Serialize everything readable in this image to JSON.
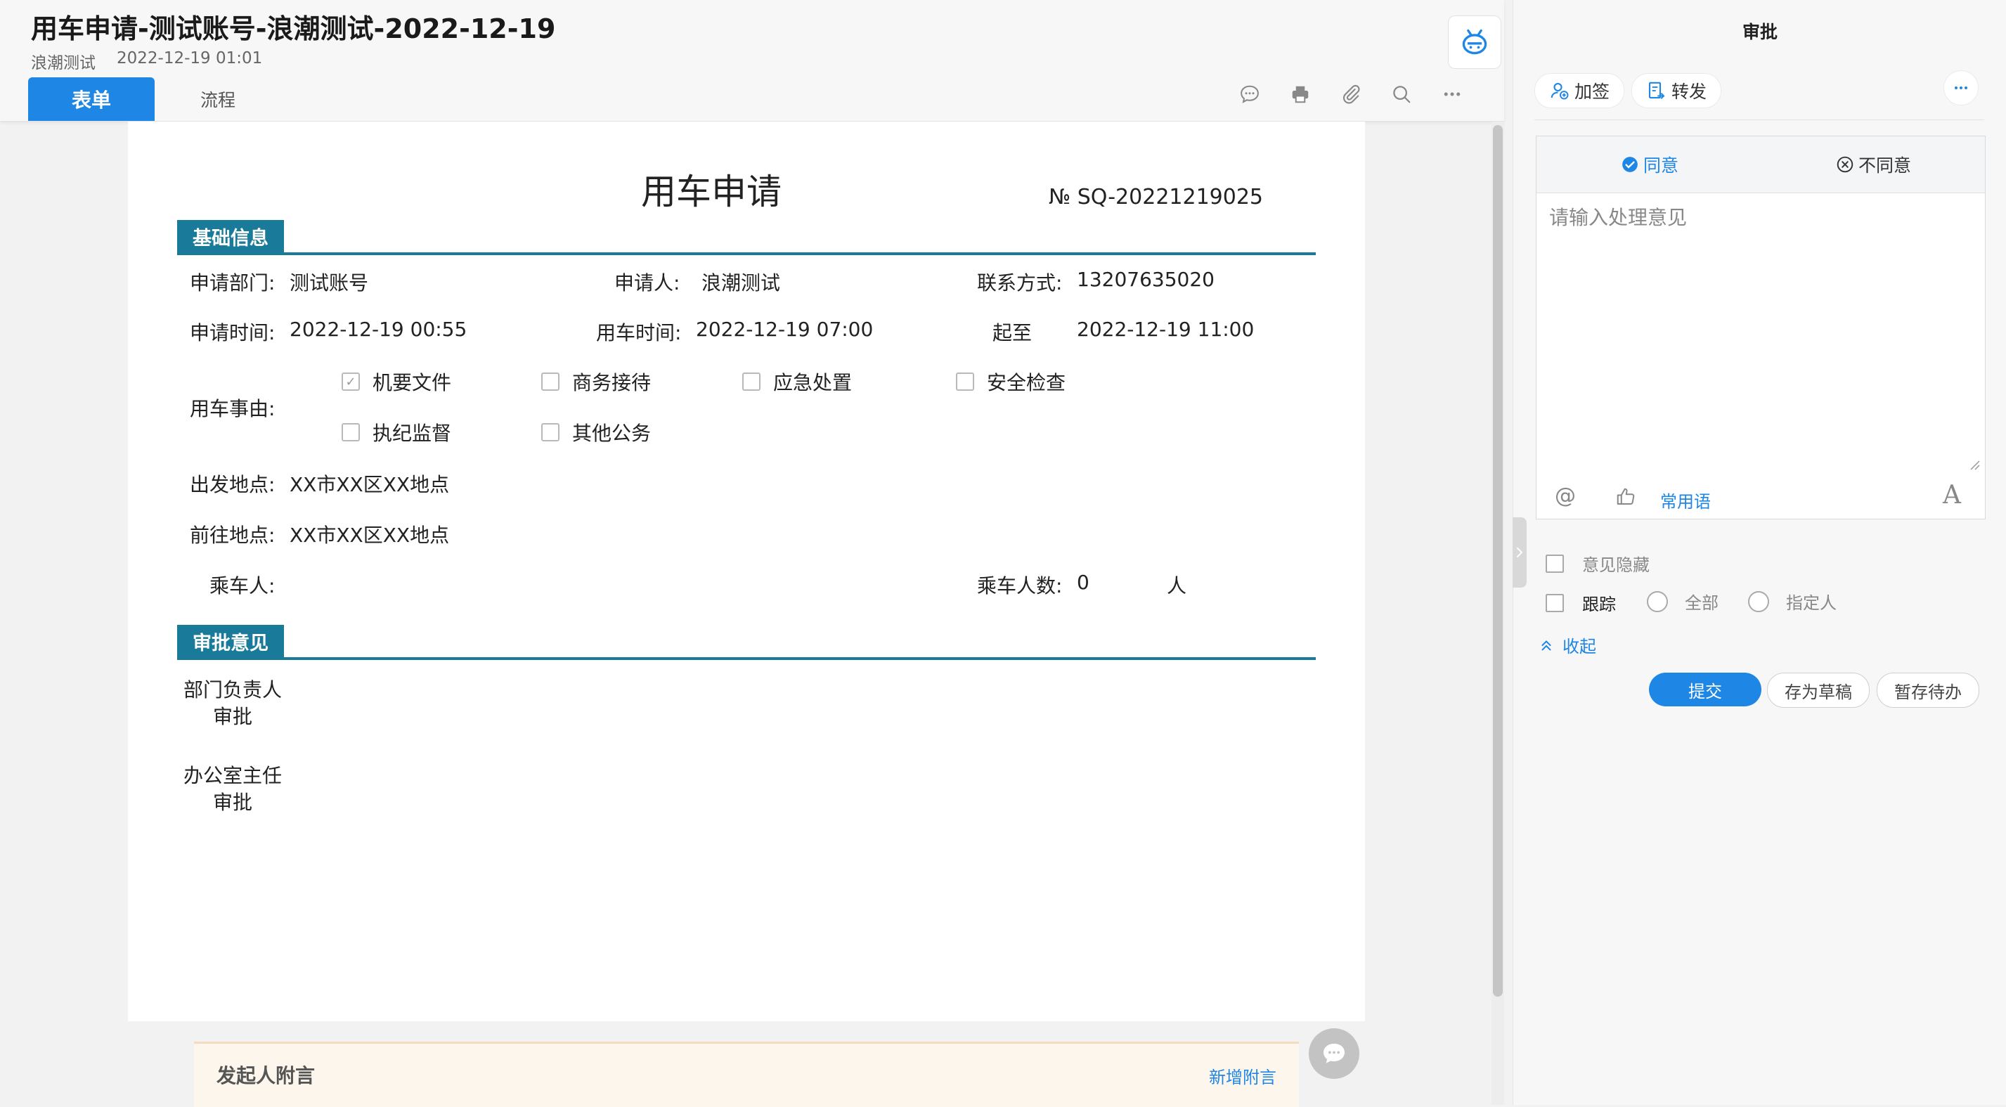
{
  "header": {
    "title": "用车申请-测试账号-浪潮测试-2022-12-19",
    "author": "浪潮测试",
    "datetime": "2022-12-19 01:01",
    "tabs": [
      {
        "label": "表单",
        "active": true
      },
      {
        "label": "流程",
        "active": false
      }
    ],
    "toolbar_icons": [
      "comment-icon",
      "print-icon",
      "attachment-icon",
      "search-icon",
      "more-icon"
    ],
    "assistant_icon": "robot-icon"
  },
  "form": {
    "title": "用车申请",
    "serial": "№ SQ-20221219025",
    "section_basic": "基础信息",
    "fields": {
      "dept_label": "申请部门:",
      "dept_value": "测试账号",
      "applicant_label": "申请人:",
      "applicant_value": "浪潮测试",
      "contact_label": "联系方式:",
      "contact_value": "13207635020",
      "apply_time_label": "申请时间:",
      "apply_time_value": "2022-12-19 00:55",
      "use_time_label": "用车时间:",
      "use_time_value": "2022-12-19 07:00",
      "until_label": "起至",
      "until_value": "2022-12-19 11:00",
      "reason_label": "用车事由:",
      "departure_label": "出发地点:",
      "departure_value": "XX市XX区XX地点",
      "destination_label": "前往地点:",
      "destination_value": "XX市XX区XX地点",
      "passenger_label": "乘车人:",
      "passenger_count_label": "乘车人数:",
      "passenger_count_value": "0",
      "passenger_unit": "人"
    },
    "reasons": [
      {
        "label": "机要文件",
        "checked": true
      },
      {
        "label": "商务接待",
        "checked": false
      },
      {
        "label": "应急处置",
        "checked": false
      },
      {
        "label": "安全检查",
        "checked": false
      },
      {
        "label": "执纪监督",
        "checked": false
      },
      {
        "label": "其他公务",
        "checked": false
      }
    ],
    "section_approval": "审批意见",
    "approvals": [
      {
        "line1": "部门负责人",
        "line2": "审批"
      },
      {
        "line1": "办公室主任",
        "line2": "审批"
      }
    ]
  },
  "remark": {
    "title": "发起人附言",
    "add_label": "新增附言"
  },
  "panel": {
    "title": "审批",
    "add_sign": "加签",
    "forward": "转发",
    "agree": "同意",
    "disagree": "不同意",
    "opinion_placeholder": "请输入处理意见",
    "phrases": "常用语",
    "hide_opinion": "意见隐藏",
    "track": "跟踪",
    "track_all": "全部",
    "track_assigned": "指定人",
    "collapse": "收起",
    "submit": "提交",
    "save_draft": "存为草稿",
    "save_pending": "暂存待办"
  },
  "colors": {
    "primary": "#1e86e5",
    "section": "#1a7a99",
    "remark_bg": "#fdf6ec"
  }
}
